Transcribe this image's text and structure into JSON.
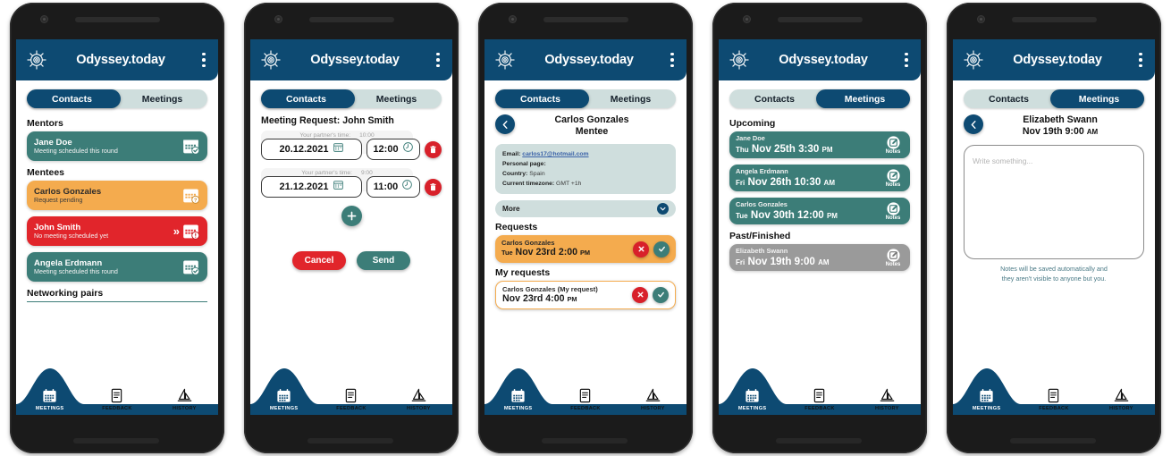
{
  "app": {
    "title": "Odyssey.today",
    "logo_icon": "ships-wheel-icon",
    "menu_icon": "kebab-menu-icon"
  },
  "tabs": {
    "contacts": "Contacts",
    "meetings": "Meetings"
  },
  "bottom_nav": [
    {
      "label": "MEETINGS",
      "icon": "calendar-icon",
      "active": true
    },
    {
      "label": "FEEDBACK",
      "icon": "document-icon",
      "active": false
    },
    {
      "label": "HISTORY",
      "icon": "sailboat-icon",
      "active": false
    }
  ],
  "screen1": {
    "active_tab": "contacts",
    "mentors_heading": "Mentors",
    "mentors": [
      {
        "name": "Jane Doe",
        "status": "Meeting scheduled this round",
        "color": "teal",
        "icon": "calendar-check-icon"
      }
    ],
    "mentees_heading": "Mentees",
    "mentees": [
      {
        "name": "Carlos Gonzales",
        "status": "Request pending",
        "color": "orange",
        "icon": "calendar-question-icon"
      },
      {
        "name": "John Smith",
        "status": "No meeting scheduled yet",
        "color": "red",
        "icon": "calendar-alert-icon",
        "chevron": "»"
      },
      {
        "name": "Angela Erdmann",
        "status": "Meeting scheduled this round",
        "color": "teal",
        "icon": "calendar-check-icon"
      }
    ],
    "networking_heading": "Networking pairs"
  },
  "screen2": {
    "active_tab": "contacts",
    "title": "Meeting Request: John Smith",
    "partner_time_label": "Your partner's time:",
    "slots": [
      {
        "partner_time": "10:00",
        "date": "20.12.2021",
        "time": "12:00"
      },
      {
        "partner_time": "9:00",
        "date": "21.12.2021",
        "time": "11:00"
      }
    ],
    "add_icon": "plus-icon",
    "delete_icon": "trash-icon",
    "date_icon": "calendar-icon",
    "time_icon": "clock-icon",
    "cancel_label": "Cancel",
    "send_label": "Send"
  },
  "screen3": {
    "active_tab": "contacts",
    "back_icon": "chevron-left-icon",
    "contact_name": "Carlos Gonzales",
    "contact_role": "Mentee",
    "info": [
      {
        "label": "Email:",
        "value": "carlos17@hotmail.com",
        "link": true
      },
      {
        "label": "Personal page:",
        "value": "",
        "link": false
      },
      {
        "label": "Country:",
        "value": "Spain",
        "link": false
      },
      {
        "label": "Current timezone:",
        "value": "GMT +1h",
        "link": false
      }
    ],
    "more_label": "More",
    "more_icon": "chevron-down-icon",
    "requests_heading": "Requests",
    "requests": [
      {
        "name": "Carlos Gonzales",
        "day": "Tue",
        "date": "Nov 23rd 2:00",
        "meridiem": "PM",
        "style": "solid"
      }
    ],
    "my_requests_heading": "My requests",
    "my_requests": [
      {
        "name": "Carlos Gonzales (My request)",
        "day": "",
        "date": "Nov 23rd 4:00",
        "meridiem": "PM",
        "style": "outline"
      }
    ],
    "decline_icon": "x-circle-icon",
    "accept_icon": "check-circle-icon"
  },
  "screen4": {
    "active_tab": "meetings",
    "upcoming_heading": "Upcoming",
    "upcoming": [
      {
        "name": "Jane Doe",
        "day": "Thu",
        "date": "Nov 25th 3:30",
        "meridiem": "PM",
        "color": "teal"
      },
      {
        "name": "Angela Erdmann",
        "day": "Fri",
        "date": "Nov 26th 10:30",
        "meridiem": "AM",
        "color": "teal"
      },
      {
        "name": "Carlos Gonzales",
        "day": "Tue",
        "date": "Nov 30th 12:00",
        "meridiem": "PM",
        "color": "teal"
      }
    ],
    "past_heading": "Past/Finished",
    "past": [
      {
        "name": "Elizabeth Swann",
        "day": "Fri",
        "date": "Nov 19th 9:00",
        "meridiem": "AM",
        "color": "grey"
      }
    ],
    "notes_label": "Notes",
    "notes_icon": "note-edit-icon"
  },
  "screen5": {
    "active_tab": "meetings",
    "back_icon": "chevron-left-icon",
    "contact_name": "Elizabeth Swann",
    "meeting_date": "Nov 19th 9:00",
    "meridiem": "AM",
    "note_placeholder": "Write something...",
    "note_value": "",
    "help_line1": "Notes will be saved automatically and",
    "help_line2": "they aren't visible to anyone but you."
  },
  "colors": {
    "brand_blue": "#0d4a72",
    "teal": "#3c7d78",
    "orange": "#f4ab4e",
    "red": "#e1252b",
    "grey": "#9a9a9a",
    "pale": "#cfdedd"
  }
}
